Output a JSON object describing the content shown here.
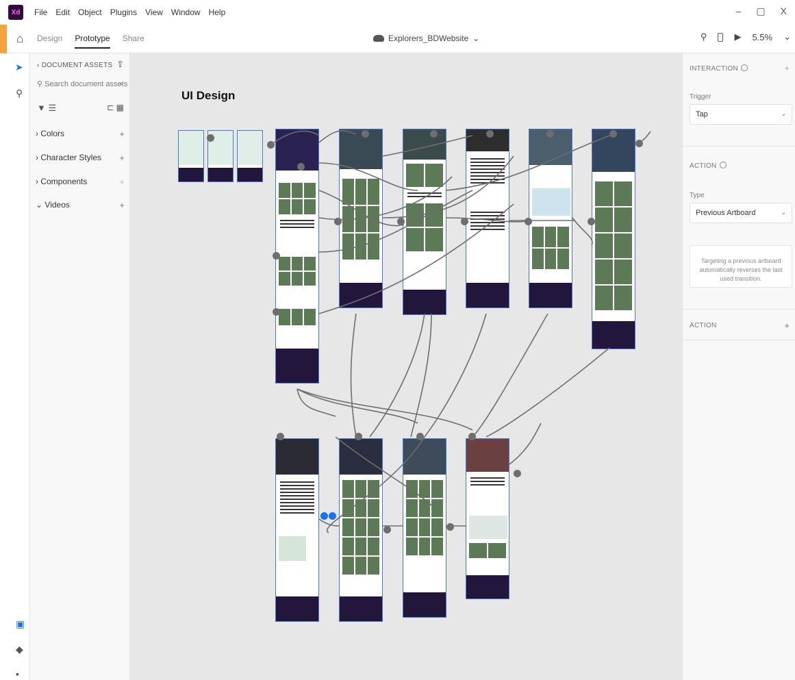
{
  "app": {
    "logo": "Xd"
  },
  "menu": [
    "File",
    "Edit",
    "Object",
    "Plugins",
    "View",
    "Window",
    "Help"
  ],
  "window_controls": {
    "minimize": "–",
    "restore": "▢",
    "close": "X"
  },
  "mode_tabs": {
    "design": "Design",
    "prototype": "Prototype",
    "share": "Share"
  },
  "document": {
    "title": "Explorers_BDWebsite",
    "chevron": "⌄"
  },
  "toolbar_right": {
    "zoom": "5.5%",
    "zoom_chevron": "⌄"
  },
  "assets_panel": {
    "header": "‹ DOCUMENT ASSETS",
    "search_placeholder": "Search document assets",
    "sections": [
      {
        "label": "Colors",
        "caret": "›"
      },
      {
        "label": "Character Styles",
        "caret": "›"
      },
      {
        "label": "Components",
        "caret": "›"
      },
      {
        "label": "Videos",
        "caret": "⌄"
      }
    ]
  },
  "canvas": {
    "title": "UI Design"
  },
  "props_panel": {
    "interaction_header": "INTERACTION",
    "trigger_label": "Trigger",
    "trigger_value": "Tap",
    "action_header": "ACTION",
    "type_label": "Type",
    "type_value": "Previous Artboard",
    "note": "Targeting a previous artboard automatically reverses the last used transition.",
    "action2_header": "ACTION"
  },
  "colors": {
    "accent": "#1a73e8",
    "footer": "#23163d",
    "canvas": "#e7e7e7",
    "wire": "#6e6e6e"
  }
}
